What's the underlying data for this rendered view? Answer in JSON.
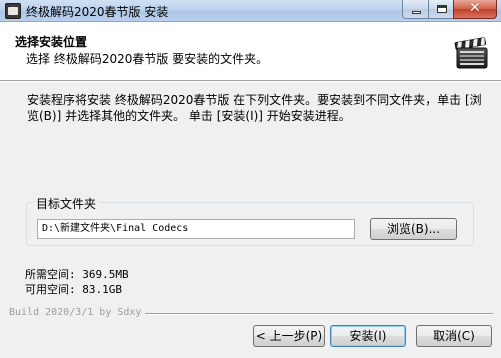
{
  "window": {
    "title": "终极解码2020春节版 安装"
  },
  "header": {
    "title": "选择安装位置",
    "subtitle": "选择 终极解码2020春节版 要安装的文件夹。",
    "icon": "film-clapperboard-icon"
  },
  "body": {
    "description": "安装程序将安装 终极解码2020春节版 在下列文件夹。要安装到不同文件夹，单击 [浏览(B)] 并选择其他的文件夹。 单击 [安装(I)] 开始安装进程。",
    "target_group_label": "目标文件夹",
    "target_path": "D:\\新建文件夹\\Final Codecs",
    "browse_label": "浏览(B)...",
    "space_required": "所需空间: 369.5MB",
    "space_available": "可用空间: 83.1GB"
  },
  "footer": {
    "build_info": "Build 2020/3/1 by Sdxy",
    "back_label": "< 上一步(P)",
    "install_label": "安装(I)",
    "cancel_label": "取消(C)"
  }
}
